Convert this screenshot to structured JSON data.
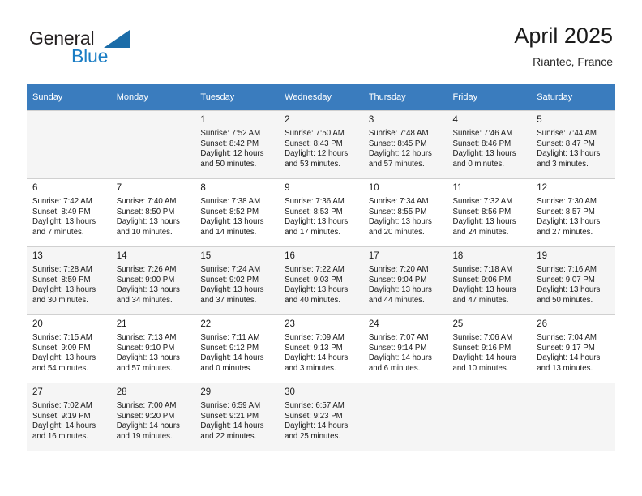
{
  "brand": {
    "name_top": "General",
    "name_bottom": "Blue",
    "color_dark": "#231f20",
    "color_blue": "#1a7dc4",
    "triangle_color": "#1b6ca8"
  },
  "header": {
    "title": "April 2025",
    "subtitle": "Riantec, France",
    "header_bg": "#3a7cbe",
    "alt_row_bg": "#f5f5f5"
  },
  "weekdays": [
    "Sunday",
    "Monday",
    "Tuesday",
    "Wednesday",
    "Thursday",
    "Friday",
    "Saturday"
  ],
  "weeks": [
    [
      {
        "day": "",
        "lines": []
      },
      {
        "day": "",
        "lines": []
      },
      {
        "day": "1",
        "lines": [
          "Sunrise: 7:52 AM",
          "Sunset: 8:42 PM",
          "Daylight: 12 hours",
          "and 50 minutes."
        ]
      },
      {
        "day": "2",
        "lines": [
          "Sunrise: 7:50 AM",
          "Sunset: 8:43 PM",
          "Daylight: 12 hours",
          "and 53 minutes."
        ]
      },
      {
        "day": "3",
        "lines": [
          "Sunrise: 7:48 AM",
          "Sunset: 8:45 PM",
          "Daylight: 12 hours",
          "and 57 minutes."
        ]
      },
      {
        "day": "4",
        "lines": [
          "Sunrise: 7:46 AM",
          "Sunset: 8:46 PM",
          "Daylight: 13 hours",
          "and 0 minutes."
        ]
      },
      {
        "day": "5",
        "lines": [
          "Sunrise: 7:44 AM",
          "Sunset: 8:47 PM",
          "Daylight: 13 hours",
          "and 3 minutes."
        ]
      }
    ],
    [
      {
        "day": "6",
        "lines": [
          "Sunrise: 7:42 AM",
          "Sunset: 8:49 PM",
          "Daylight: 13 hours",
          "and 7 minutes."
        ]
      },
      {
        "day": "7",
        "lines": [
          "Sunrise: 7:40 AM",
          "Sunset: 8:50 PM",
          "Daylight: 13 hours",
          "and 10 minutes."
        ]
      },
      {
        "day": "8",
        "lines": [
          "Sunrise: 7:38 AM",
          "Sunset: 8:52 PM",
          "Daylight: 13 hours",
          "and 14 minutes."
        ]
      },
      {
        "day": "9",
        "lines": [
          "Sunrise: 7:36 AM",
          "Sunset: 8:53 PM",
          "Daylight: 13 hours",
          "and 17 minutes."
        ]
      },
      {
        "day": "10",
        "lines": [
          "Sunrise: 7:34 AM",
          "Sunset: 8:55 PM",
          "Daylight: 13 hours",
          "and 20 minutes."
        ]
      },
      {
        "day": "11",
        "lines": [
          "Sunrise: 7:32 AM",
          "Sunset: 8:56 PM",
          "Daylight: 13 hours",
          "and 24 minutes."
        ]
      },
      {
        "day": "12",
        "lines": [
          "Sunrise: 7:30 AM",
          "Sunset: 8:57 PM",
          "Daylight: 13 hours",
          "and 27 minutes."
        ]
      }
    ],
    [
      {
        "day": "13",
        "lines": [
          "Sunrise: 7:28 AM",
          "Sunset: 8:59 PM",
          "Daylight: 13 hours",
          "and 30 minutes."
        ]
      },
      {
        "day": "14",
        "lines": [
          "Sunrise: 7:26 AM",
          "Sunset: 9:00 PM",
          "Daylight: 13 hours",
          "and 34 minutes."
        ]
      },
      {
        "day": "15",
        "lines": [
          "Sunrise: 7:24 AM",
          "Sunset: 9:02 PM",
          "Daylight: 13 hours",
          "and 37 minutes."
        ]
      },
      {
        "day": "16",
        "lines": [
          "Sunrise: 7:22 AM",
          "Sunset: 9:03 PM",
          "Daylight: 13 hours",
          "and 40 minutes."
        ]
      },
      {
        "day": "17",
        "lines": [
          "Sunrise: 7:20 AM",
          "Sunset: 9:04 PM",
          "Daylight: 13 hours",
          "and 44 minutes."
        ]
      },
      {
        "day": "18",
        "lines": [
          "Sunrise: 7:18 AM",
          "Sunset: 9:06 PM",
          "Daylight: 13 hours",
          "and 47 minutes."
        ]
      },
      {
        "day": "19",
        "lines": [
          "Sunrise: 7:16 AM",
          "Sunset: 9:07 PM",
          "Daylight: 13 hours",
          "and 50 minutes."
        ]
      }
    ],
    [
      {
        "day": "20",
        "lines": [
          "Sunrise: 7:15 AM",
          "Sunset: 9:09 PM",
          "Daylight: 13 hours",
          "and 54 minutes."
        ]
      },
      {
        "day": "21",
        "lines": [
          "Sunrise: 7:13 AM",
          "Sunset: 9:10 PM",
          "Daylight: 13 hours",
          "and 57 minutes."
        ]
      },
      {
        "day": "22",
        "lines": [
          "Sunrise: 7:11 AM",
          "Sunset: 9:12 PM",
          "Daylight: 14 hours",
          "and 0 minutes."
        ]
      },
      {
        "day": "23",
        "lines": [
          "Sunrise: 7:09 AM",
          "Sunset: 9:13 PM",
          "Daylight: 14 hours",
          "and 3 minutes."
        ]
      },
      {
        "day": "24",
        "lines": [
          "Sunrise: 7:07 AM",
          "Sunset: 9:14 PM",
          "Daylight: 14 hours",
          "and 6 minutes."
        ]
      },
      {
        "day": "25",
        "lines": [
          "Sunrise: 7:06 AM",
          "Sunset: 9:16 PM",
          "Daylight: 14 hours",
          "and 10 minutes."
        ]
      },
      {
        "day": "26",
        "lines": [
          "Sunrise: 7:04 AM",
          "Sunset: 9:17 PM",
          "Daylight: 14 hours",
          "and 13 minutes."
        ]
      }
    ],
    [
      {
        "day": "27",
        "lines": [
          "Sunrise: 7:02 AM",
          "Sunset: 9:19 PM",
          "Daylight: 14 hours",
          "and 16 minutes."
        ]
      },
      {
        "day": "28",
        "lines": [
          "Sunrise: 7:00 AM",
          "Sunset: 9:20 PM",
          "Daylight: 14 hours",
          "and 19 minutes."
        ]
      },
      {
        "day": "29",
        "lines": [
          "Sunrise: 6:59 AM",
          "Sunset: 9:21 PM",
          "Daylight: 14 hours",
          "and 22 minutes."
        ]
      },
      {
        "day": "30",
        "lines": [
          "Sunrise: 6:57 AM",
          "Sunset: 9:23 PM",
          "Daylight: 14 hours",
          "and 25 minutes."
        ]
      },
      {
        "day": "",
        "lines": []
      },
      {
        "day": "",
        "lines": []
      },
      {
        "day": "",
        "lines": []
      }
    ]
  ]
}
